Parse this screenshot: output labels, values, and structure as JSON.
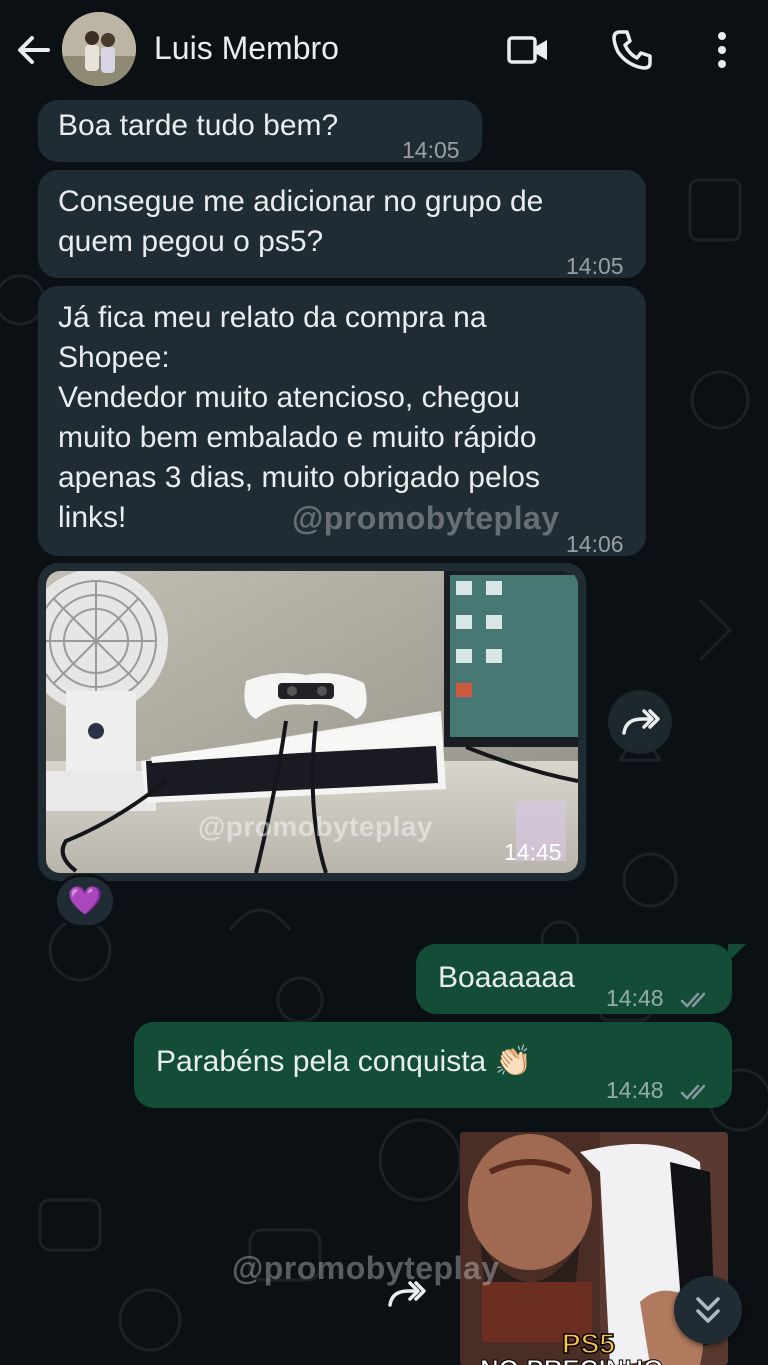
{
  "header": {
    "contact_name": "Luis Membro"
  },
  "messages": [
    {
      "text": "Boa tarde tudo bem?",
      "time": "14:05"
    },
    {
      "text": "Consegue me adicionar no grupo de\nquem pegou o ps5?",
      "time": "14:05"
    },
    {
      "text": "Já fica meu relato da compra na\nShopee:\nVendedor muito atencioso, chegou\nmuito bem embalado e muito rápido\napenas 3 dias, muito obrigado pelos\nlinks!",
      "time": "14:06"
    },
    {
      "type": "image",
      "time": "14:45",
      "reaction": "💜"
    },
    {
      "text": "Boaaaaaa",
      "time": "14:48"
    },
    {
      "text": "Parabéns pela conquista 👏🏻",
      "time": "14:48"
    }
  ],
  "watermark": "@promobyteplay",
  "sticker": {
    "label": "PS5",
    "sub_label": "NO PRECINHO"
  },
  "colors": {
    "incoming": "#1f2c33",
    "outgoing": "#134d37",
    "background": "#0b1014",
    "tick_read": "#8696a0"
  }
}
